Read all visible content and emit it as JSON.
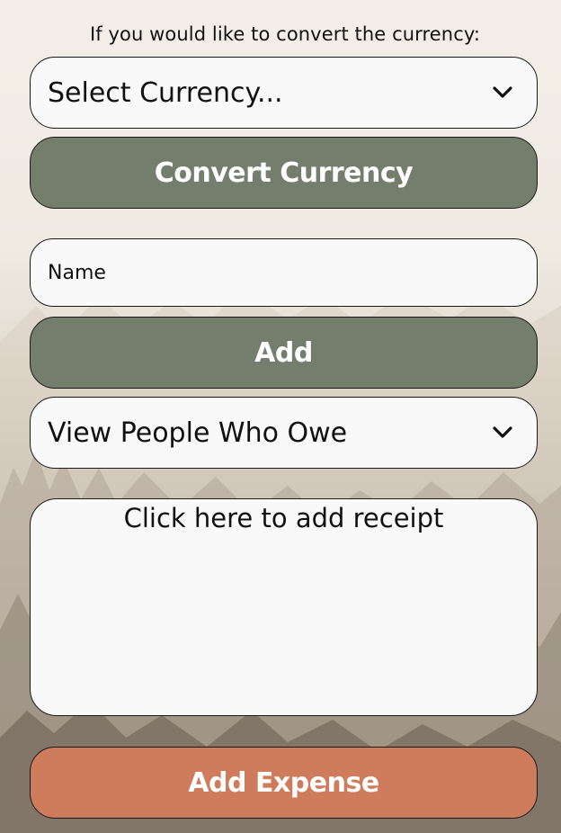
{
  "currency": {
    "prompt": "If you would like to convert the currency:",
    "select_label": "Select Currency...",
    "convert_button": "Convert Currency"
  },
  "people": {
    "name_placeholder": "Name",
    "add_button": "Add",
    "view_label": "View People Who Owe"
  },
  "receipt": {
    "label": "Click here to add receipt"
  },
  "expense": {
    "add_button": "Add Expense"
  },
  "colors": {
    "green_button": "#737f6c",
    "orange_button": "#cf7c5c",
    "field_background": "#f9f9fa"
  },
  "icons": {
    "currency_dropdown": "chevron-down-icon",
    "people_dropdown": "chevron-down-icon"
  }
}
